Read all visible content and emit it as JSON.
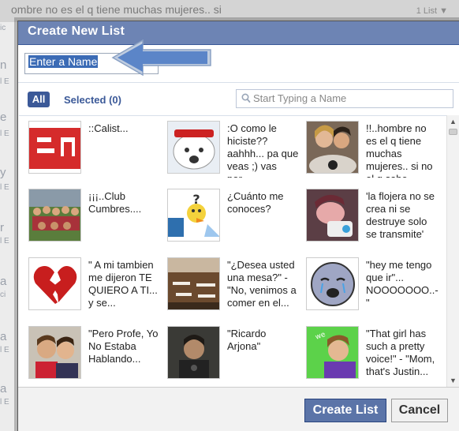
{
  "background": {
    "top_text": "ombre no es el q tiene muchas mujeres.. si",
    "count_text": "1 List ▼",
    "left_fragments": [
      "ic",
      "n",
      "l E",
      "e",
      "l E",
      "y",
      "l E",
      "r",
      "l E",
      "a",
      "ci",
      "a",
      "l E",
      "a",
      "l E"
    ]
  },
  "dialog": {
    "title": "Create New List",
    "name_input_value": "Enter a Name",
    "filter": {
      "all_label": "All",
      "selected_label": "Selected (0)"
    },
    "search_placeholder": "Start Typing a Name",
    "items": [
      {
        "label": "::Calist...",
        "icon": "red-logo"
      },
      {
        "label": ":O como le hiciste?? aahhh... pa que veas ;) vas por...",
        "icon": "cartoon-face"
      },
      {
        "label": "!!..hombre no es el q tiene muchas mujeres.. si no el q sabe...",
        "icon": "couple-photo"
      },
      {
        "label": "¡¡¡..Club Cumbres....",
        "icon": "group-photo"
      },
      {
        "label": "¿Cuánto me conoces?",
        "icon": "quiz-bird"
      },
      {
        "label": "'la flojera no se crea ni se destruye solo se transmite'",
        "icon": "sleeping-person"
      },
      {
        "label": "\" A mi tambien me dijeron TE QUIERO A TI... y se...",
        "icon": "broken-heart"
      },
      {
        "label": "\"¿Desea usted una mesa?\" -\"No, venimos a comer en el...",
        "icon": "restaurant-photo"
      },
      {
        "label": "\"hey me tengo que ir\"... NOOOOOOO..-\"",
        "icon": "crying-face"
      },
      {
        "label": "\"Pero Profe, Yo No Estaba Hablando...",
        "icon": "teens-photo"
      },
      {
        "label": "\"Ricardo Arjona\"",
        "icon": "singer-photo"
      },
      {
        "label": "\"That girl has such a pretty voice!\" - \"Mom, that's Justin...",
        "icon": "justin-photo"
      }
    ],
    "buttons": {
      "create": "Create List",
      "cancel": "Cancel"
    },
    "colors": {
      "title_bar": "#6d84b4",
      "accent": "#3b5998",
      "selection": "#3b6bb5"
    }
  }
}
